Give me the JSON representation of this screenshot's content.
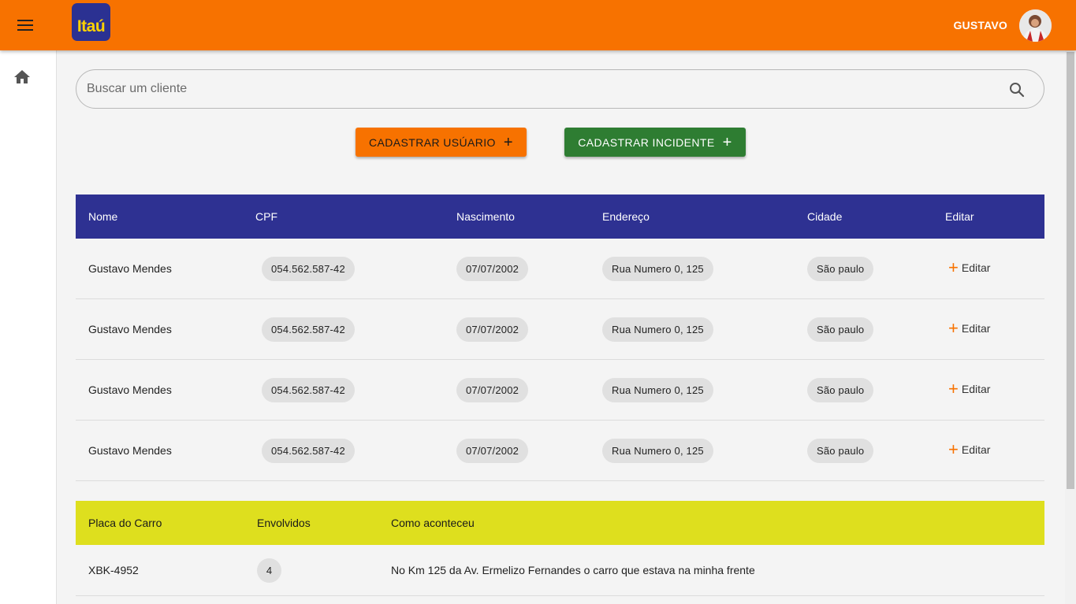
{
  "header": {
    "logo_text": "Itaú",
    "username": "GUSTAVO",
    "brand_color": "#f77200",
    "logo_bg": "#2b3192",
    "logo_text_color": "#ffd200"
  },
  "sidebar": {
    "items": [
      {
        "icon": "home-icon"
      }
    ]
  },
  "search": {
    "placeholder": "Buscar um cliente",
    "value": ""
  },
  "actions": {
    "add_user_label": "CADASTRAR USÚARIO",
    "add_incident_label": "CADASTRAR INCIDENTE",
    "plus": "+"
  },
  "clients_table": {
    "header_color": "#2e3192",
    "columns": [
      "Nome",
      "CPF",
      "Nascimento",
      "Endereço",
      "Cidade",
      "Editar"
    ],
    "edit_label": "Editar",
    "rows": [
      {
        "name": "Gustavo Mendes",
        "cpf": "054.562.587-42",
        "birth": "07/07/2002",
        "address": "Rua Numero 0, 125",
        "city": "São paulo"
      },
      {
        "name": "Gustavo Mendes",
        "cpf": "054.562.587-42",
        "birth": "07/07/2002",
        "address": "Rua Numero 0, 125",
        "city": "São paulo"
      },
      {
        "name": "Gustavo Mendes",
        "cpf": "054.562.587-42",
        "birth": "07/07/2002",
        "address": "Rua Numero 0, 125",
        "city": "São paulo"
      },
      {
        "name": "Gustavo Mendes",
        "cpf": "054.562.587-42",
        "birth": "07/07/2002",
        "address": "Rua Numero 0, 125",
        "city": "São paulo"
      }
    ]
  },
  "incidents_table": {
    "header_color": "#dedf1e",
    "columns": [
      "Placa do Carro",
      "Envolvidos",
      "Como aconteceu"
    ],
    "rows": [
      {
        "plate": "XBK-4952",
        "involved": "4",
        "description": "No Km 125 da Av. Ermelizo Fernandes o carro que estava na minha frente"
      }
    ]
  }
}
